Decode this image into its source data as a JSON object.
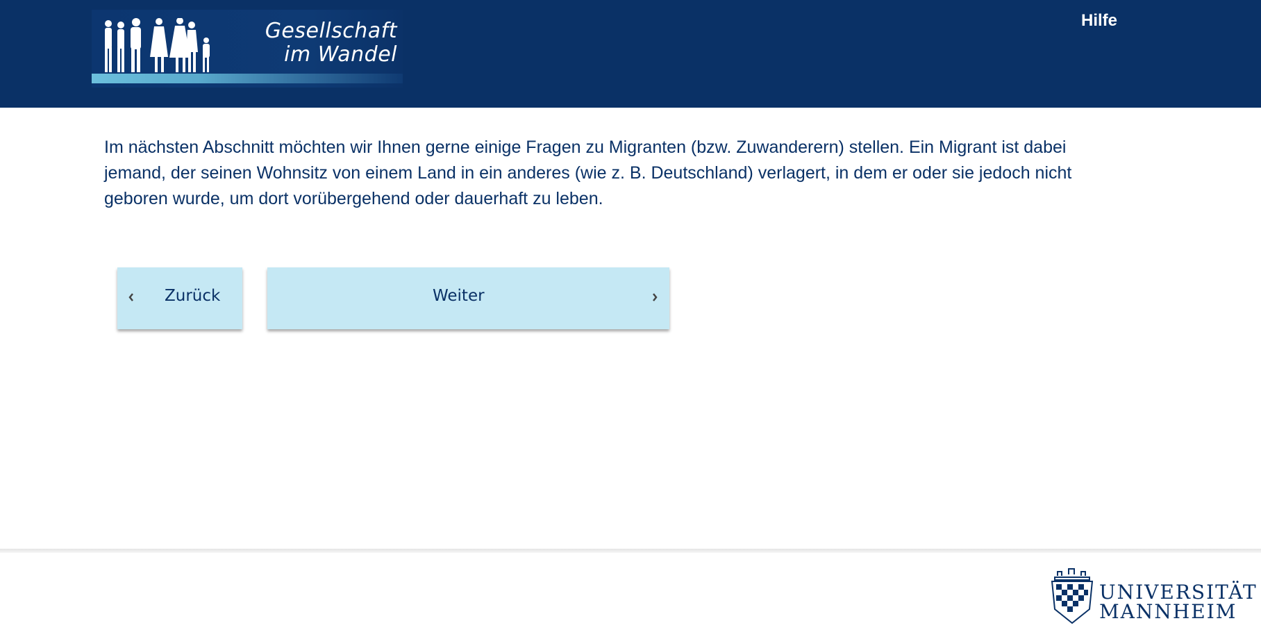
{
  "header": {
    "logo": {
      "title_line1": "Gesellschaft",
      "title_line2": "im Wandel"
    },
    "help_label": "Hilfe"
  },
  "main": {
    "intro_text": "Im nächsten Abschnitt möchten wir Ihnen gerne einige Fragen zu Migranten (bzw. Zuwanderern) stellen. Ein Migrant ist dabei jemand, der seinen Wohnsitz von einem Land in ein anderes (wie z. B. Deutschland) verlagert, in dem er oder sie jedoch nicht geboren wurde, um dort vorübergehend oder dauerhaft zu leben."
  },
  "navigation": {
    "back_label": "Zurück",
    "back_icon": "chevron-left-icon",
    "next_label": "Weiter",
    "next_icon": "chevron-right-icon"
  },
  "footer": {
    "university_line1": "UNIVERSITÄT",
    "university_line2": "MANNHEIM"
  },
  "colors": {
    "header_bg": "#0a3166",
    "text_primary": "#0a3166",
    "button_bg": "#c5e8f4"
  }
}
